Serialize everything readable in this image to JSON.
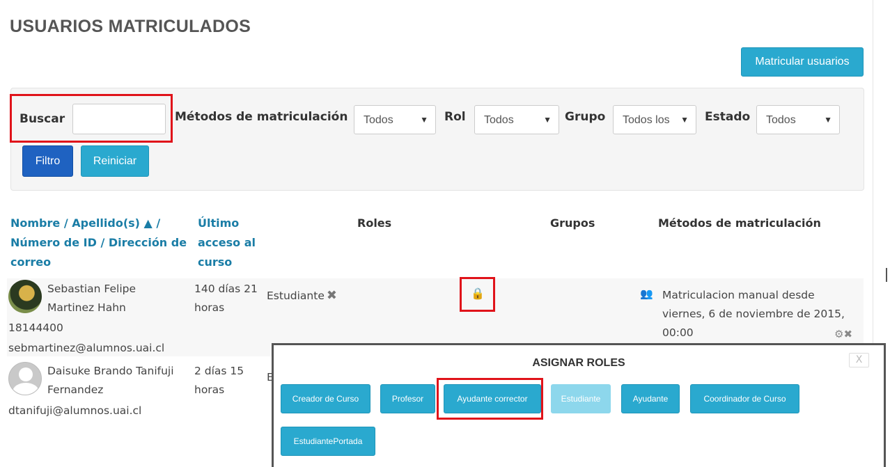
{
  "page": {
    "title": "USUARIOS MATRICULADOS"
  },
  "toolbar": {
    "enrol_button": "Matricular usuarios"
  },
  "filters": {
    "search_label": "Buscar",
    "search_value": "",
    "methods_label": "Métodos de matriculación",
    "methods_value": "Todos",
    "role_label": "Rol",
    "role_value": "Todos",
    "group_label": "Grupo",
    "group_value": "Todos los",
    "status_label": "Estado",
    "status_value": "Todos",
    "filter_button": "Filtro",
    "reset_button": "Reiniciar"
  },
  "table": {
    "headers": {
      "name_line1": "Nombre / Apellido(s) ▲ /",
      "name_line2": "Número de ID / Dirección de",
      "name_line3": "correo",
      "last_access_line1": "Último",
      "last_access_line2": "acceso al",
      "last_access_line3": "curso",
      "roles": "Roles",
      "groups": "Grupos",
      "methods": "Métodos de matriculación"
    },
    "rows": [
      {
        "name_line1": "Sebastian Felipe",
        "name_line2": "Martinez Hahn",
        "id_number": "18144400",
        "email": "sebmartinez@alumnos.uai.cl",
        "last_access_line1": "140 días 21",
        "last_access_line2": "horas",
        "role": "Estudiante",
        "method_line1": "Matriculacion manual desde",
        "method_line2": "viernes, 6 de noviembre de 2015,",
        "method_line3": "00:00"
      },
      {
        "name_line1": "Daisuke Brando Tanifuji",
        "name_line2": "Fernandez",
        "email": "dtanifuji@alumnos.uai.cl",
        "last_access_line1": "2 días 15",
        "last_access_line2": "horas",
        "role_partial": "E"
      }
    ]
  },
  "modal": {
    "title": "ASIGNAR ROLES",
    "close": "X",
    "roles": [
      "Creador de Curso",
      "Profesor",
      "Ayudante corrector",
      "Estudiante",
      "Ayudante",
      "Coordinador de Curso",
      "EstudiantePortada"
    ]
  },
  "icons": {
    "sort": "sort-asc-icon",
    "remove_role": "close-icon",
    "assign_role": "lock-icon",
    "enrol_method": "users-icon",
    "method_actions": "gear-icon"
  },
  "colors": {
    "accent": "#2aa9cf",
    "primary": "#1f62c1",
    "link": "#1a7da6",
    "highlight": "#e0131a"
  }
}
